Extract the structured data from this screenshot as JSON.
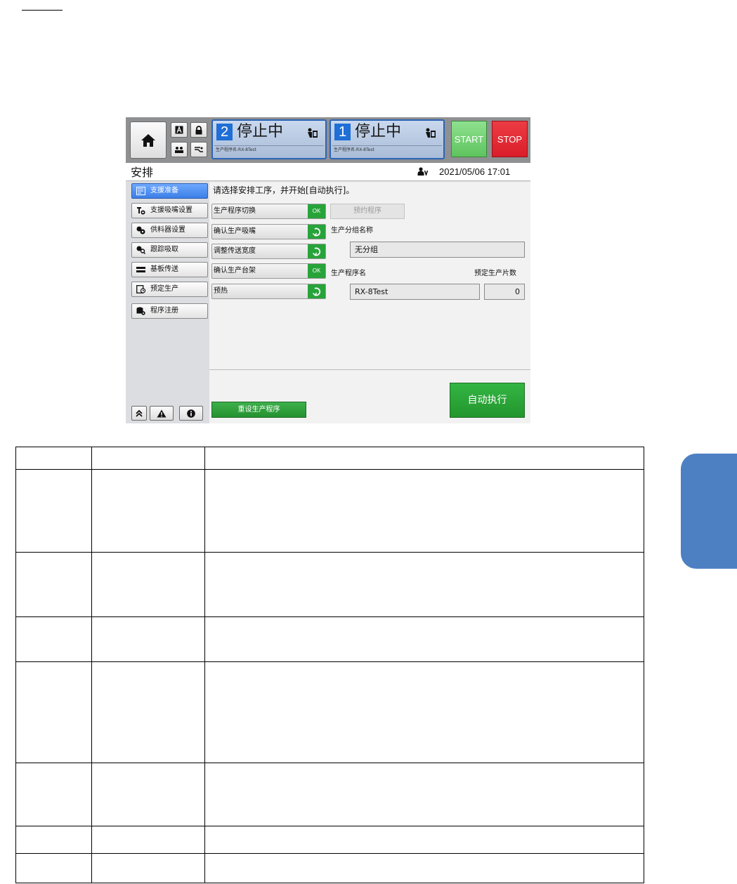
{
  "header": {
    "lanes": [
      {
        "number": "2",
        "status": "停止中",
        "program": "生产程序名:RX-8Test"
      },
      {
        "number": "1",
        "status": "停止中",
        "program": "生产程序名:RX-8Test"
      }
    ],
    "start_label": "START",
    "stop_label": "STOP"
  },
  "title_bar": {
    "title": "安排",
    "datetime": "2021/05/06 17:01"
  },
  "sidebar": {
    "items": [
      {
        "label": "支援准备",
        "active": true
      },
      {
        "label": "支援吸嘴设置"
      },
      {
        "label": "供料器设置"
      },
      {
        "label": "跟踪吸取"
      },
      {
        "label": "基板传送"
      },
      {
        "label": "预定生产"
      },
      {
        "label": "程序注册"
      }
    ]
  },
  "main": {
    "instruction": "请选择安排工序，并开始[自动执行]。",
    "steps": [
      {
        "label": "生产程序切换",
        "state": "OK"
      },
      {
        "label": "确认生产吸嘴",
        "state": "go"
      },
      {
        "label": "调整传送宽度",
        "state": "go"
      },
      {
        "label": "确认生产台架",
        "state": "OK"
      },
      {
        "label": "预热",
        "state": "go"
      }
    ],
    "reserve_program_label": "预约程序",
    "group_name_label": "生产分组名称",
    "group_name_value": "无分组",
    "program_name_label": "生产程序名",
    "program_name_value": "RX-8Test",
    "planned_count_label": "预定生产片数",
    "planned_count_value": "0",
    "reset_button_label": "重设生产程序",
    "auto_button_label": "自动执行"
  },
  "colors": {
    "accent_blue": "#1f6fd6",
    "ok_green": "#27a33a",
    "stop_red": "#d91e2a",
    "start_green": "#5ec45e",
    "side_tab_blue": "#4d80c2"
  }
}
